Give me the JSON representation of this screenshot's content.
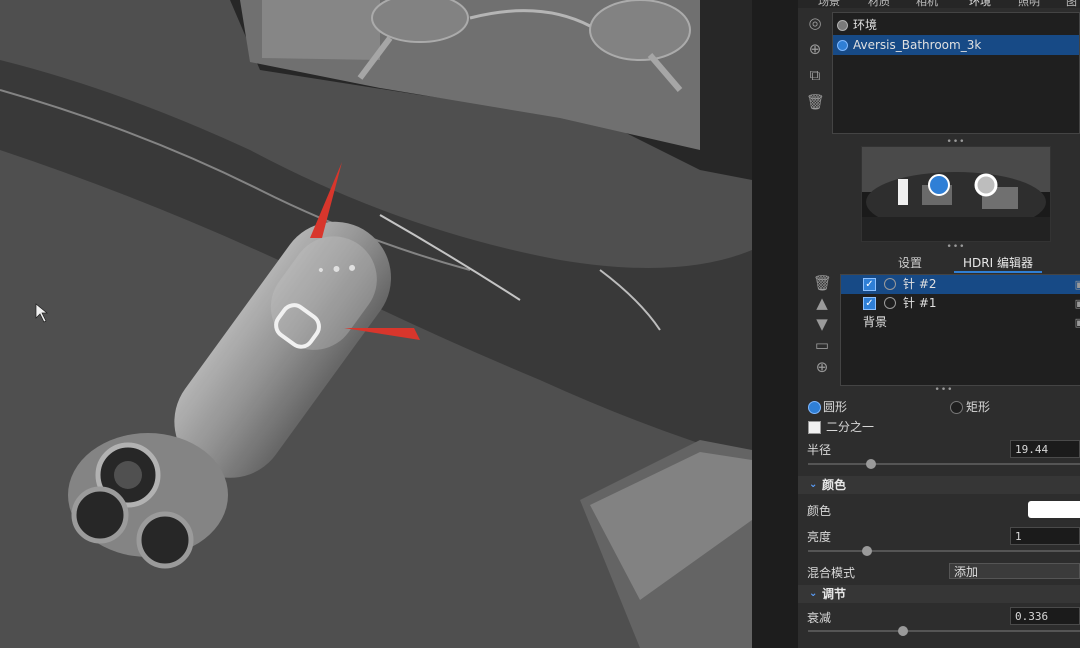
{
  "panel": {
    "top_tabs": [
      "场景",
      "材质",
      "相机",
      "环境",
      "照明",
      "图"
    ],
    "top_tabs_active": "环境",
    "env_list": {
      "items": [
        {
          "label": "环境",
          "selected": false
        },
        {
          "label": "Aversis_Bathroom_3k",
          "selected": true
        }
      ]
    },
    "hdri_tabs": {
      "settings": "设置",
      "editor": "HDRI 编辑器",
      "active": "HDRI 编辑器"
    },
    "pins": [
      {
        "label": "针 #2",
        "checked": true,
        "selected": true
      },
      {
        "label": "针 #1",
        "checked": true,
        "selected": false
      }
    ],
    "background_label": "背景",
    "shape": {
      "circle_label": "圆形",
      "rect_label": "矩形",
      "selected": "圆形"
    },
    "half_label": "二分之一",
    "radius": {
      "label": "半径",
      "value": "19.44"
    },
    "color_section": {
      "title": "颜色",
      "color_label": "颜色",
      "color_value": "#ffffff"
    },
    "brightness": {
      "label": "亮度",
      "value": "1"
    },
    "blend_mode": {
      "label": "混合模式",
      "value": "添加"
    },
    "adjust_section": {
      "title": "调节"
    },
    "falloff": {
      "label": "衰减",
      "value": "0.336"
    }
  }
}
